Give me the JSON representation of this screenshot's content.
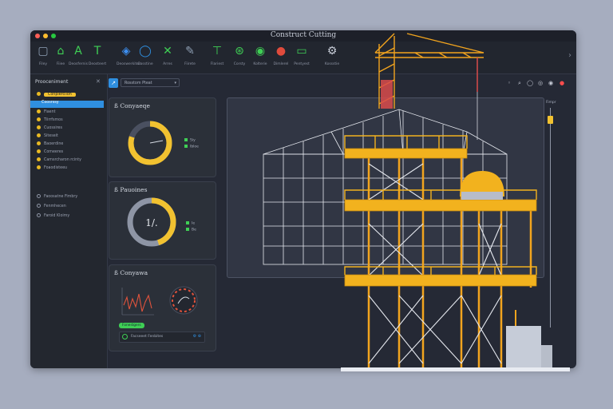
{
  "window": {
    "title": "Construct Cutting",
    "traffic": [
      "#ff5f57",
      "#febc2e",
      "#28c840"
    ]
  },
  "toolbar": {
    "tools": [
      {
        "label": "Filey",
        "icon": "file-icon",
        "color": "#8fa0b5"
      },
      {
        "label": "Fiiee",
        "icon": "house-icon",
        "color": "#3fcf55"
      },
      {
        "label": "Deosfernis",
        "icon": "letter-a-icon",
        "color": "#3fcf55"
      },
      {
        "label": "Deosteert",
        "icon": "letter-t-icon",
        "color": "#3fcf55"
      },
      {
        "label": "Deoswerkiton",
        "icon": "cube-icon",
        "color": "#3d8ff0"
      },
      {
        "label": "Cosstine",
        "icon": "ring-icon",
        "color": "#2f8fe0"
      },
      {
        "label": "Arres",
        "icon": "tools-icon",
        "color": "#3fcf55"
      },
      {
        "label": "Fiirete",
        "icon": "pen-icon",
        "color": "#8fa0b5"
      },
      {
        "label": "Flariest",
        "icon": "crane-icon",
        "color": "#3fcf55"
      },
      {
        "label": "Corsty",
        "icon": "globe-icon",
        "color": "#3fcf55"
      },
      {
        "label": "Kolterie",
        "icon": "circle-icon",
        "color": "#3fcf55"
      },
      {
        "label": "Dimlerel",
        "icon": "color-wheel-icon",
        "color": "#e04b3c"
      },
      {
        "label": "Pentyest",
        "icon": "layers-icon",
        "color": "#3fcf55"
      },
      {
        "label": "Kossstie",
        "icon": "settings-icon",
        "color": "#c8cdd8"
      }
    ],
    "overflow_icon": "chevron-right-icon"
  },
  "sidebar": {
    "header": "Prooceniment",
    "items": [
      {
        "label": "Conplerciion",
        "style": "badge"
      },
      {
        "label": "Coosrssy",
        "style": "active"
      },
      {
        "label": "Fiaent",
        "style": "bullet"
      },
      {
        "label": "Tiirrfsmos",
        "style": "bullet"
      },
      {
        "label": "Cuossires",
        "style": "bullet"
      },
      {
        "label": "Siteseit",
        "style": "bullet"
      },
      {
        "label": "Baoerdine",
        "style": "bullet"
      },
      {
        "label": "Comeeres",
        "style": "bullet"
      },
      {
        "label": "Camsrcharon rcinty",
        "style": "bullet"
      },
      {
        "label": "Foaodisteeu",
        "style": "bullet"
      }
    ],
    "lower_items": [
      {
        "label": "Faoosatne Fimbry"
      },
      {
        "label": "Fenmhecen"
      },
      {
        "label": "Faroid Kloimy"
      }
    ]
  },
  "main": {
    "dropdown_value": "Rosstom Pteat",
    "cards": [
      {
        "title": "Conyaeqe",
        "value": 0.8,
        "center": "",
        "legend": [
          "Siy",
          "Ibloe"
        ],
        "color": "#f2c230"
      },
      {
        "title": "Pauoines",
        "value": 0.45,
        "center": "1/.",
        "legend": [
          "Ie",
          "Be"
        ],
        "color": "#f2c230"
      },
      {
        "title": "Conyawa",
        "value": null,
        "center": "",
        "legend": [],
        "color": "#f2c230",
        "footer_badge": "Fonestgers",
        "footer_row": "Facseeet Fenbites"
      }
    ]
  },
  "right_panel": {
    "label": "Fimpr"
  }
}
